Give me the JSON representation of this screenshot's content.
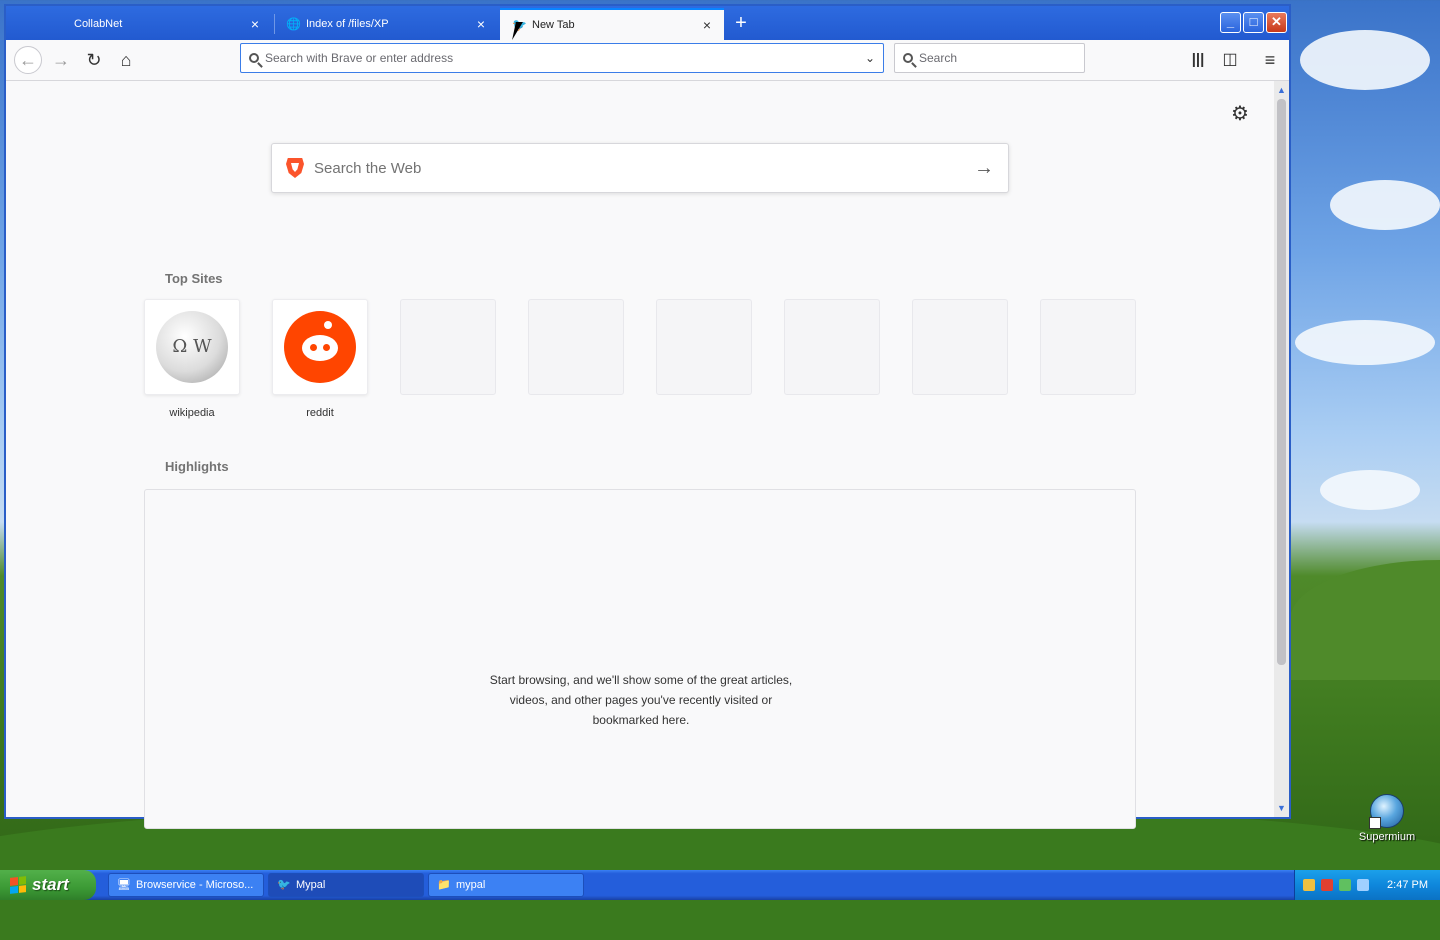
{
  "browser": {
    "tabs": [
      {
        "label": "CollabNet",
        "icon": "blank-page-icon",
        "active": false
      },
      {
        "label": "Index of /files/XP",
        "icon": "globe-icon",
        "active": false
      },
      {
        "label": "New Tab",
        "icon": "mypal-icon",
        "active": true
      }
    ],
    "window_controls": {
      "minimize": "_",
      "maximize": "□",
      "close": "✕"
    },
    "new_tab_symbol": "+",
    "urlbar": {
      "placeholder": "Search with Brave or enter address",
      "value": ""
    },
    "searchbar": {
      "placeholder": "Search",
      "value": ""
    }
  },
  "newtab": {
    "web_search_placeholder": "Search the Web",
    "top_sites_title": "Top Sites",
    "top_sites": [
      {
        "label": "wikipedia",
        "icon": "wikipedia-icon"
      },
      {
        "label": "reddit",
        "icon": "reddit-icon"
      },
      {
        "label": "",
        "icon": ""
      },
      {
        "label": "",
        "icon": ""
      },
      {
        "label": "",
        "icon": ""
      },
      {
        "label": "",
        "icon": ""
      },
      {
        "label": "",
        "icon": ""
      },
      {
        "label": "",
        "icon": ""
      }
    ],
    "highlights_title": "Highlights",
    "highlights_empty_lines": [
      "Start browsing, and we'll show some of the great articles,",
      "videos, and other pages you've recently visited or",
      "bookmarked here."
    ]
  },
  "desktop": {
    "icons": [
      {
        "label": "Supermium",
        "icon": "supermium-icon"
      }
    ]
  },
  "taskbar": {
    "start_label": "start",
    "tasks": [
      {
        "label": "Browservice - Microso...",
        "icon": "browservice-icon",
        "active": false
      },
      {
        "label": "Mypal",
        "icon": "mypal-icon",
        "active": true
      },
      {
        "label": "mypal",
        "icon": "folder-icon",
        "active": false
      }
    ],
    "clock": "2:47 PM"
  },
  "colors": {
    "accent": "#0a84ff",
    "taskbar": "#245edb",
    "start": "#3c9a35",
    "reddit": "#ff4500",
    "brave": "#fb542b"
  }
}
